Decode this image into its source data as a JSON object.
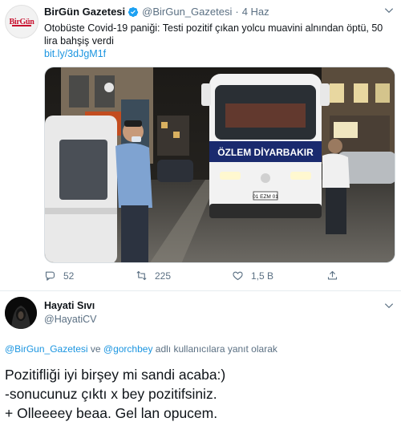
{
  "tweet": {
    "avatar_logo": "BirGün",
    "author_name": "BirGün Gazetesi",
    "author_handle": "@BirGun_Gazetesi",
    "separator": "·",
    "date": "4 Haz",
    "text": "Otobüste Covid-19 paniği: Testi pozitif çıkan yolcu muavini alnından öptü, 50 lira bahşiş verdi",
    "link": "bit.ly/3dJgM1f",
    "photo": {
      "bus_sign": "ÖZLEM DİYARBAKIR",
      "bus_plate": "01 EZM 01"
    },
    "actions": {
      "reply_count": "52",
      "retweet_count": "225",
      "like_count": "1,5 B"
    }
  },
  "reply": {
    "author_name": "Hayati Sıvı",
    "author_handle": "@HayatiCV",
    "replying_mention_1": "@BirGun_Gazetesi",
    "replying_and": " ve ",
    "replying_mention_2": "@gorchbey",
    "replying_suffix": " adlı kullanıcılara yanıt olarak",
    "lines": [
      "Pozitifliği iyi birşey mi sandi acaba:)",
      "-sonucunuz çıktı x bey pozitifsiniz.",
      "+ Olleeeey beaa. Gel lan opucem."
    ]
  },
  "colors": {
    "link_blue": "#1b95e0",
    "muted_gray": "#5b7083",
    "logo_red": "#c8102e"
  }
}
